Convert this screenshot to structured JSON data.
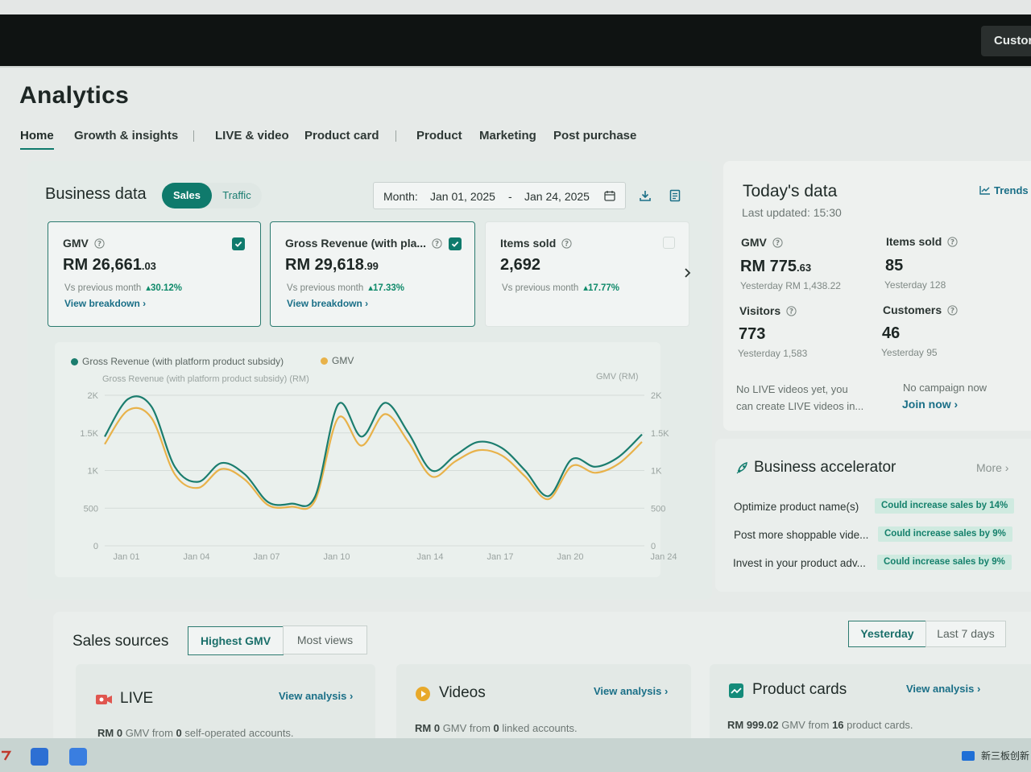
{
  "header": {
    "customer_button": "Custor"
  },
  "page_title": "Analytics",
  "tabs": [
    "Home",
    "Growth & insights",
    "LIVE & video",
    "Product card",
    "Product",
    "Marketing",
    "Post purchase"
  ],
  "business": {
    "title": "Business data",
    "toggle_on": "Sales",
    "toggle_off": "Traffic",
    "date_prefix": "Month:",
    "date_start": "Jan 01, 2025",
    "date_dash": "-",
    "date_end": "Jan 24, 2025",
    "metrics": [
      {
        "label": "GMV",
        "currency": "RM",
        "value_main": "26,661",
        "value_dec": ".03",
        "compare": "Vs previous month",
        "change": "30.12%",
        "link": "View breakdown",
        "checked": true
      },
      {
        "label": "Gross Revenue (with pla...",
        "currency": "RM",
        "value_main": "29,618",
        "value_dec": ".99",
        "compare": "Vs previous month",
        "change": "17.33%",
        "link": "View breakdown",
        "checked": true
      },
      {
        "label": "Items sold",
        "value_main": "2,692",
        "compare": "Vs previous month",
        "change": "17.77%",
        "checked": false
      }
    ]
  },
  "chart_data": {
    "type": "line",
    "legend": [
      "Gross Revenue (with platform product subsidy)",
      "GMV"
    ],
    "ylabel_left": "Gross Revenue (with platform product subsidy) (RM)",
    "ylabel_right": "GMV (RM)",
    "y_ticks_left": [
      "0",
      "500",
      "1K",
      "1.5K",
      "2K"
    ],
    "y_ticks_right": [
      "0",
      "500",
      "1K",
      "1.5K",
      "2K"
    ],
    "ylim": [
      0,
      2000
    ],
    "x_ticks": [
      "Jan 01",
      "Jan 04",
      "Jan 07",
      "Jan 10",
      "Jan 14",
      "Jan 17",
      "Jan 20",
      "Jan 24"
    ],
    "x": [
      "Jan 01",
      "Jan 02",
      "Jan 03",
      "Jan 04",
      "Jan 05",
      "Jan 06",
      "Jan 07",
      "Jan 08",
      "Jan 09",
      "Jan 10",
      "Jan 11",
      "Jan 12",
      "Jan 13",
      "Jan 14",
      "Jan 15",
      "Jan 16",
      "Jan 17",
      "Jan 18",
      "Jan 19",
      "Jan 20",
      "Jan 21",
      "Jan 22",
      "Jan 23",
      "Jan 24"
    ],
    "series": [
      {
        "name": "Gross Revenue (with platform product subsidy)",
        "color": "#1b7d6e",
        "values": [
          1450,
          1950,
          1850,
          1050,
          850,
          1100,
          950,
          580,
          560,
          650,
          1880,
          1450,
          1900,
          1500,
          1000,
          1200,
          1380,
          1300,
          1000,
          660,
          1150,
          1050,
          1180,
          1480
        ]
      },
      {
        "name": "GMV",
        "color": "#e8b24a",
        "values": [
          1350,
          1800,
          1700,
          950,
          770,
          1020,
          880,
          540,
          520,
          600,
          1700,
          1330,
          1750,
          1380,
          920,
          1120,
          1270,
          1200,
          920,
          620,
          1060,
          970,
          1090,
          1380
        ]
      }
    ]
  },
  "today": {
    "title": "Today's data",
    "updated": "Last updated: 15:30",
    "trends": "Trends",
    "gmv_label": "GMV",
    "gmv_currency": "RM",
    "gmv_main": "775",
    "gmv_dec": ".63",
    "gmv_yesterday": "Yesterday RM 1,438.22",
    "items_label": "Items sold",
    "items_value": "85",
    "items_yesterday": "Yesterday 128",
    "visitors_label": "Visitors",
    "visitors_value": "773",
    "visitors_yesterday": "Yesterday 1,583",
    "customers_label": "Customers",
    "customers_value": "46",
    "customers_yesterday": "Yesterday 95",
    "live_note_1": "No LIVE videos yet, you",
    "live_note_2": "can create LIVE videos in...",
    "campaign_note": "No campaign now",
    "join_now": "Join now"
  },
  "accelerator": {
    "title": "Business accelerator",
    "more": "More",
    "rows": [
      {
        "label": "Optimize product name(s)",
        "badge": "Could increase sales by 14%"
      },
      {
        "label": "Post more shoppable vide...",
        "badge": "Could increase sales by 9%"
      },
      {
        "label": "Invest in your product adv...",
        "badge": "Could increase sales by 9%"
      }
    ]
  },
  "sales_sources": {
    "title": "Sales sources",
    "seg_a": "Highest GMV",
    "seg_b": "Most views",
    "period_a": "Yesterday",
    "period_b": "Last 7 days",
    "cards": [
      {
        "title": "LIVE",
        "link": "View analysis",
        "amount": "RM 0",
        "mid": "GMV from",
        "count": "0",
        "tail": "self-operated accounts."
      },
      {
        "title": "Videos",
        "link": "View analysis",
        "amount": "RM 0",
        "mid": "GMV from",
        "count": "0",
        "tail": "linked accounts."
      },
      {
        "title": "Product cards",
        "link": "View analysis",
        "amount": "RM 999.02",
        "mid": "GMV from",
        "count": "16",
        "tail": "product cards."
      }
    ]
  },
  "taskbar": {
    "tray_text": "新三板创新"
  }
}
